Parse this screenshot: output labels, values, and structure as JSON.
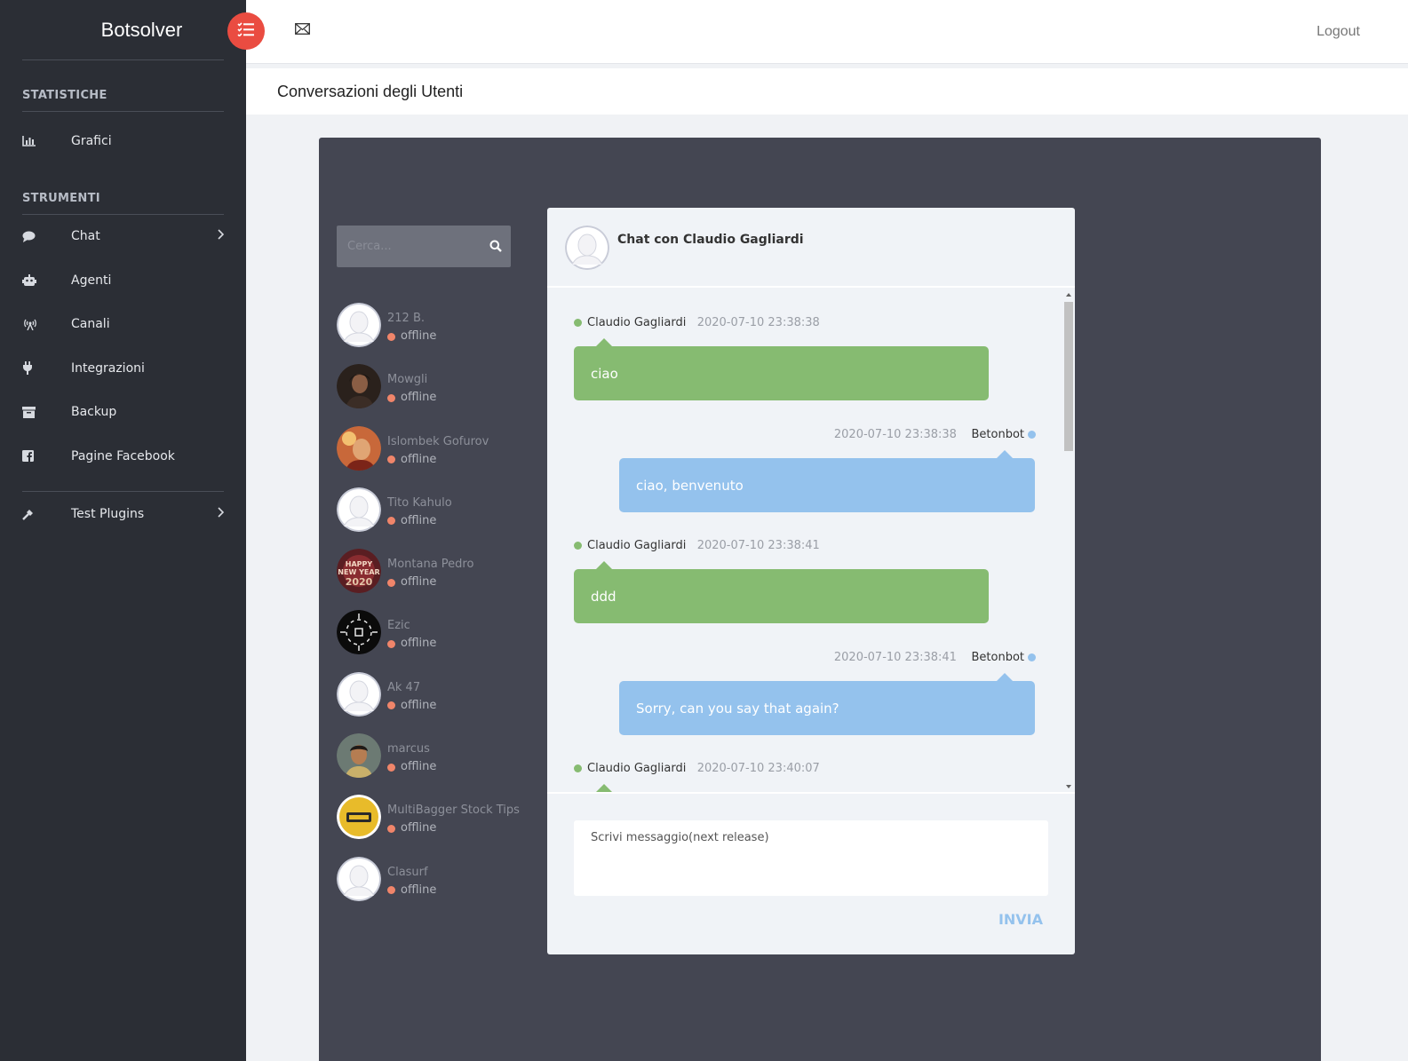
{
  "app": {
    "brand": "Botsolver",
    "logout": "Logout",
    "page_title": "Conversazioni degli Utenti"
  },
  "sidebar": {
    "sections": [
      {
        "title": "STATISTICHE",
        "items": [
          {
            "label": "Grafici",
            "icon": "bar-chart-icon"
          }
        ]
      },
      {
        "title": "STRUMENTI",
        "items": [
          {
            "label": "Chat",
            "icon": "chat-bubble-icon",
            "submenu": true
          },
          {
            "label": "Agenti",
            "icon": "robot-icon"
          },
          {
            "label": "Canali",
            "icon": "broadcast-icon"
          },
          {
            "label": "Integrazioni",
            "icon": "plug-icon"
          },
          {
            "label": "Backup",
            "icon": "archive-icon"
          },
          {
            "label": "Pagine Facebook",
            "icon": "facebook-square-icon"
          }
        ]
      }
    ],
    "extra": [
      {
        "label": "Test Plugins",
        "icon": "wrench-icon",
        "submenu": true
      }
    ]
  },
  "search": {
    "placeholder": "Cerca..."
  },
  "contacts": [
    {
      "name": "212 B.",
      "status": "offline",
      "avatar": "default"
    },
    {
      "name": "Mowgli",
      "status": "offline",
      "avatar": "photo-dark"
    },
    {
      "name": "Islombek Gofurov",
      "status": "offline",
      "avatar": "photo-warm"
    },
    {
      "name": "Tito Kahulo",
      "status": "offline",
      "avatar": "default"
    },
    {
      "name": "Montana Pedro",
      "status": "offline",
      "avatar": "photo-newyear"
    },
    {
      "name": "Ezic",
      "status": "offline",
      "avatar": "photo-logo"
    },
    {
      "name": "Ak 47",
      "status": "offline",
      "avatar": "default"
    },
    {
      "name": "marcus",
      "status": "offline",
      "avatar": "photo-person"
    },
    {
      "name": "MultiBagger Stock Tips",
      "status": "offline",
      "avatar": "photo-yellow"
    },
    {
      "name": "Clasurf",
      "status": "offline",
      "avatar": "default"
    }
  ],
  "chat": {
    "title": "Chat con Claudio Gagliardi",
    "messages": [
      {
        "from": "Claudio Gagliardi",
        "time": "2020-07-10 23:38:38",
        "text": "ciao",
        "side": "user"
      },
      {
        "from": "Betonbot",
        "time": "2020-07-10 23:38:38",
        "text": "ciao, benvenuto",
        "side": "bot"
      },
      {
        "from": "Claudio Gagliardi",
        "time": "2020-07-10 23:38:41",
        "text": "ddd",
        "side": "user"
      },
      {
        "from": "Betonbot",
        "time": "2020-07-10 23:38:41",
        "text": "Sorry, can you say that again?",
        "side": "bot"
      },
      {
        "from": "Claudio Gagliardi",
        "time": "2020-07-10 23:40:07",
        "text": "",
        "side": "user"
      }
    ],
    "composer_placeholder": "Scrivi messaggio(next release)",
    "send_label": "INVIA"
  },
  "colors": {
    "sidebar": "#2b2e35",
    "accent": "#ea4c41",
    "user_bubble": "#86bb71",
    "bot_bubble": "#94c2ed",
    "offline": "#f0856a"
  }
}
